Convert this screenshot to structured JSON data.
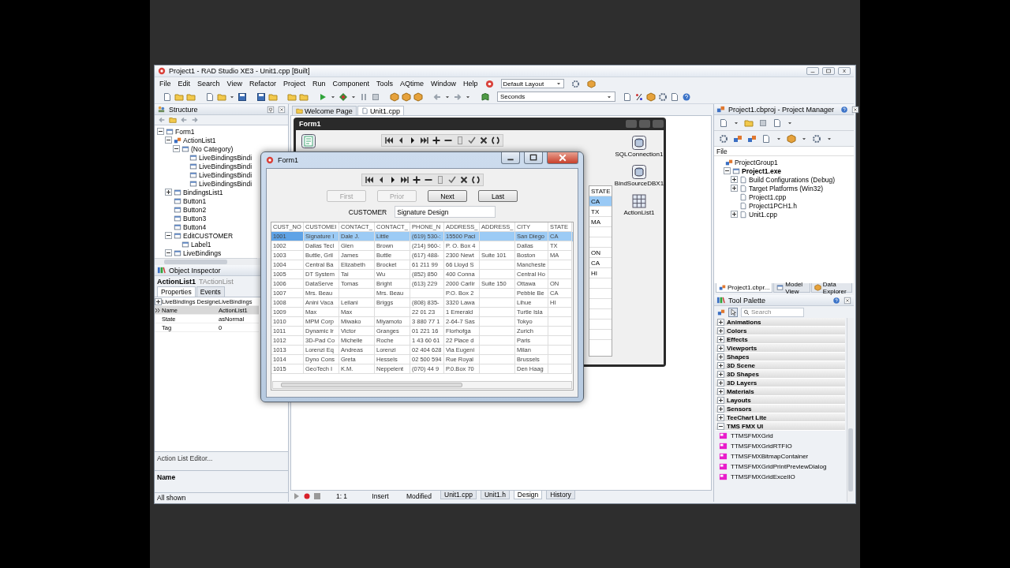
{
  "window": {
    "title": "Project1 - RAD Studio XE3 - Unit1.cpp [Built]"
  },
  "menu": [
    "File",
    "Edit",
    "Search",
    "View",
    "Refactor",
    "Project",
    "Run",
    "Component",
    "Tools",
    "AQtime",
    "Window",
    "Help"
  ],
  "layout_combo": {
    "value": "Default Layout"
  },
  "toolbar": {
    "combo": {
      "value": "Seconds"
    }
  },
  "structure": {
    "title": "Structure",
    "tree": [
      {
        "label": "Form1",
        "expanded": true,
        "children": [
          {
            "label": "ActionList1",
            "expanded": true,
            "children": [
              {
                "label": "(No Category)",
                "expanded": true,
                "children": [
                  {
                    "label": "LiveBindingsBindi"
                  },
                  {
                    "label": "LiveBindingsBindi"
                  },
                  {
                    "label": "LiveBindingsBindi"
                  },
                  {
                    "label": "LiveBindingsBindi"
                  }
                ]
              }
            ]
          },
          {
            "label": "BindingsList1",
            "expanded": false
          },
          {
            "label": "Button1"
          },
          {
            "label": "Button2"
          },
          {
            "label": "Button3"
          },
          {
            "label": "Button4"
          },
          {
            "label": "EditCUSTOMER",
            "expanded": true,
            "children": [
              {
                "label": "Label1"
              }
            ]
          },
          {
            "label": "LiveBindings",
            "expanded": true
          }
        ]
      }
    ]
  },
  "inspector": {
    "title": "Object Inspector",
    "object": "ActionList1",
    "type": "TActionList",
    "tabs": [
      {
        "label": "Properties",
        "selected": true
      },
      {
        "label": "Events",
        "selected": false
      }
    ],
    "properties": [
      {
        "name": "LiveBindings Designe",
        "value": "LiveBindings",
        "expanded": false,
        "selected": false
      },
      {
        "name": "Name",
        "value": "ActionList1",
        "selected": true
      },
      {
        "name": "State",
        "value": "asNormal",
        "selected": false
      },
      {
        "name": "Tag",
        "value": "0",
        "selected": false
      }
    ],
    "action": "Action List Editor...",
    "description": "Name",
    "status": "All shown"
  },
  "editor_tabs": [
    {
      "label": "Welcome Page",
      "selected": false
    },
    {
      "label": "Unit1.cpp",
      "selected": true
    }
  ],
  "designer": {
    "title": "Form1",
    "state_column": {
      "header": "STATE",
      "cells": [
        {
          "text": "CA",
          "selected": true
        },
        {
          "text": "TX",
          "selected": false
        },
        {
          "text": "MA",
          "selected": false
        },
        {
          "text": null,
          "selected": false
        },
        {
          "text": null,
          "selected": false
        },
        {
          "text": "ON",
          "selected": false
        },
        {
          "text": "CA",
          "selected": false
        },
        {
          "text": "HI",
          "selected": false
        }
      ]
    },
    "components": [
      {
        "label": "SQLConnection1",
        "kind": "dbx"
      },
      {
        "label": "BindSourceDBX1",
        "kind": "dbx"
      },
      {
        "label": "ActionList1",
        "kind": "actionlist"
      }
    ]
  },
  "form": {
    "title": "Form1",
    "buttons": [
      {
        "label": "First",
        "disabled": true
      },
      {
        "label": "Prior",
        "disabled": true
      },
      {
        "label": "Next",
        "disabled": false
      },
      {
        "label": "Last",
        "disabled": false
      }
    ],
    "customer_label": "CUSTOMER",
    "customer_field": {
      "value": "Signature Design"
    },
    "grid": {
      "columns": [
        "CUST_NO",
        "CUSTOMEI",
        "CONTACT_",
        "CONTACT_",
        "PHONE_N",
        "ADDRESS_",
        "ADDRESS_",
        "CITY",
        "STATE"
      ],
      "rows": [
        {
          "selected": true,
          "cells": [
            "1001",
            "Signature I",
            "Dale J.",
            "Little",
            "(619) 530-:",
            "15500 Paci",
            null,
            "San Diego",
            "CA"
          ]
        },
        {
          "selected": false,
          "cells": [
            "1002",
            "Dallas Tecl",
            "Glen",
            "Brown",
            "(214) 960-:",
            "P. O. Box 4",
            null,
            "Dallas",
            "TX"
          ]
        },
        {
          "selected": false,
          "cells": [
            "1003",
            "Buttle, Gril",
            "James",
            "Buttle",
            "(617) 488-",
            "2300 Newt",
            "Suite 101",
            "Boston",
            "MA"
          ]
        },
        {
          "selected": false,
          "cells": [
            "1004",
            "Central Ba",
            "Elizabeth",
            "Brocket",
            "61 211 99",
            "66 Lloyd S",
            null,
            "Mancheste",
            null
          ]
        },
        {
          "selected": false,
          "cells": [
            "1005",
            "DT System",
            "Tai",
            "Wu",
            "(852) 850",
            "400 Conna",
            null,
            "Central Ho",
            null
          ]
        },
        {
          "selected": false,
          "cells": [
            "1006",
            "DataServe",
            "Tomas",
            "Bright",
            "(613) 229",
            "2000 Carlir",
            "Suite 150",
            "Ottawa",
            "ON"
          ]
        },
        {
          "selected": false,
          "cells": [
            "1007",
            "Mrs. Beau",
            null,
            "Mrs. Beau",
            null,
            "P.O. Box 2",
            null,
            "Pebble Be",
            "CA"
          ]
        },
        {
          "selected": false,
          "cells": [
            "1008",
            "Anini Vaca",
            "Leilani",
            "Briggs",
            "(808) 835-",
            "3320 Lawa",
            null,
            "Lihue",
            "HI"
          ]
        },
        {
          "selected": false,
          "cells": [
            "1009",
            "Max",
            "Max",
            null,
            "22 01 23",
            "1 Emerald",
            null,
            "Turtle Isla",
            null
          ]
        },
        {
          "selected": false,
          "cells": [
            "1010",
            "MPM Corp",
            "Miwako",
            "Miyamoto",
            "3 880 77 1",
            "2-64-7 Sas",
            null,
            "Tokyo",
            null
          ]
        },
        {
          "selected": false,
          "cells": [
            "1011",
            "Dynamic Ir",
            "Victor",
            "Granges",
            "01 221 16",
            "Florhofga",
            null,
            "Zurich",
            null
          ]
        },
        {
          "selected": false,
          "cells": [
            "1012",
            "3D-Pad Co",
            "Michelle",
            "Roche",
            "1 43 60 61",
            "22 Place d",
            null,
            "Paris",
            null
          ]
        },
        {
          "selected": false,
          "cells": [
            "1013",
            "Lorenzi Eq",
            "Andreas",
            "Lorenzi",
            "02 404 628",
            "Via Eugeni",
            null,
            "Milan",
            null
          ]
        },
        {
          "selected": false,
          "cells": [
            "1014",
            "Dyno Cons",
            "Greta",
            "Hessels",
            "02 500 594",
            "Rue Royal",
            null,
            "Brussels",
            null
          ]
        },
        {
          "selected": false,
          "cells": [
            "1015",
            "GeoTech I",
            "K.M.",
            "Neppelent",
            "(070) 44 9",
            "P.0.Box 70",
            null,
            "Den Haag",
            null
          ]
        }
      ]
    }
  },
  "status_bar": {
    "position": "1: 1",
    "mode": "Insert",
    "state": "Modified",
    "tabs": [
      {
        "label": "Unit1.cpp",
        "selected": false
      },
      {
        "label": "Unit1.h",
        "selected": false
      },
      {
        "label": "Design",
        "selected": true
      },
      {
        "label": "History",
        "selected": false
      }
    ]
  },
  "project_manager": {
    "title": "Project1.cbproj - Project Manager",
    "column": "File",
    "tree": [
      {
        "label": "ProjectGroup1",
        "children": [
          {
            "label": "Project1.exe",
            "active": true,
            "expanded": true,
            "children": [
              {
                "label": "Build Configurations (Debug)",
                "expanded": false
              },
              {
                "label": "Target Platforms (Win32)",
                "expanded": false
              },
              {
                "label": "Project1.cpp"
              },
              {
                "label": "Project1PCH1.h"
              },
              {
                "label": "Unit1.cpp",
                "expanded": false
              }
            ]
          }
        ]
      }
    ],
    "tabs": [
      {
        "label": "Project1.cbpr...",
        "selected": true
      },
      {
        "label": "Model View",
        "selected": false
      },
      {
        "label": "Data Explorer",
        "selected": false
      }
    ]
  },
  "tool_palette": {
    "title": "Tool Palette",
    "search": {
      "placeholder": "Search"
    },
    "categories": [
      {
        "label": "Animations",
        "expanded": false
      },
      {
        "label": "Colors",
        "expanded": false
      },
      {
        "label": "Effects",
        "expanded": false
      },
      {
        "label": "Viewports",
        "expanded": false
      },
      {
        "label": "Shapes",
        "expanded": false
      },
      {
        "label": "3D Scene",
        "expanded": false
      },
      {
        "label": "3D Shapes",
        "expanded": false
      },
      {
        "label": "3D Layers",
        "expanded": false
      },
      {
        "label": "Materials",
        "expanded": false
      },
      {
        "label": "Layouts",
        "expanded": false
      },
      {
        "label": "Sensors",
        "expanded": false
      },
      {
        "label": "TeeChart Lite",
        "expanded": false
      },
      {
        "label": "TMS FMX UI",
        "expanded": true,
        "items": [
          "TTMSFMXGrid",
          "TTMSFMXGridRTFIO",
          "TTMSFMXBitmapContainer",
          "TTMSFMXGridPrintPreviewDialog",
          "TTMSFMXGridExcelIO"
        ]
      }
    ]
  }
}
